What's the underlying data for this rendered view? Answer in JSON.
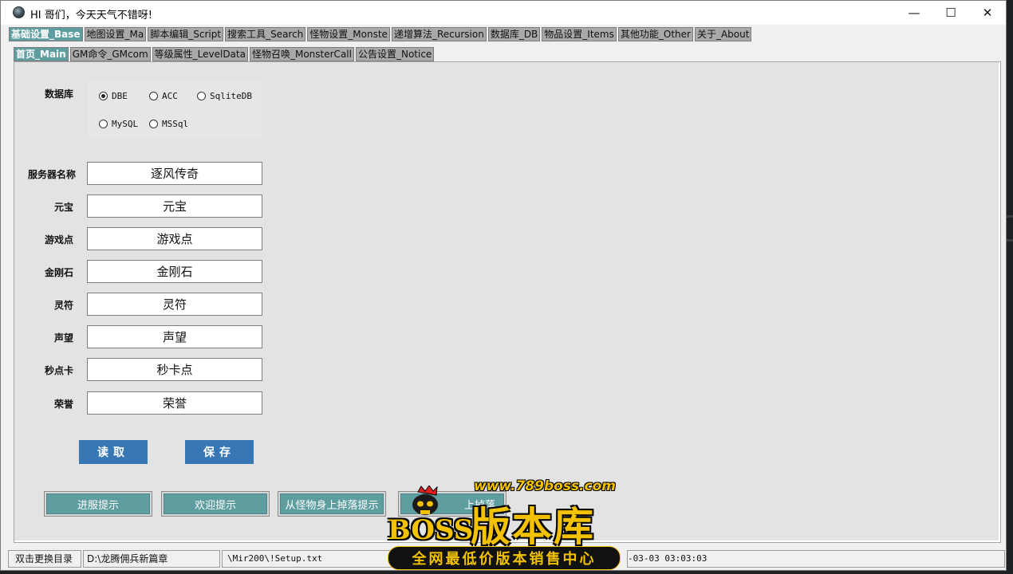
{
  "window": {
    "title": "HI 哥们，今天天气不错呀!",
    "minimize_glyph": "—",
    "maximize_glyph": "☐",
    "close_glyph": "✕"
  },
  "main_tabs": [
    {
      "label": "基础设置_Base",
      "active": true
    },
    {
      "label": "地图设置_Ma",
      "active": false
    },
    {
      "label": "脚本编辑_Script",
      "active": false
    },
    {
      "label": "搜索工具_Search",
      "active": false
    },
    {
      "label": "怪物设置_Monste",
      "active": false
    },
    {
      "label": "递增算法_Recursion",
      "active": false
    },
    {
      "label": "数据库_DB",
      "active": false
    },
    {
      "label": "物品设置_Items",
      "active": false
    },
    {
      "label": "其他功能_Other",
      "active": false
    },
    {
      "label": "关于_About",
      "active": false
    }
  ],
  "sub_tabs": [
    {
      "label": "首页_Main",
      "active": true
    },
    {
      "label": "GM命令_GMcom",
      "active": false
    },
    {
      "label": "等级属性_LevelData",
      "active": false
    },
    {
      "label": "怪物召唤_MonsterCall",
      "active": false
    },
    {
      "label": "公告设置_Notice",
      "active": false
    }
  ],
  "database": {
    "label": "数据库",
    "options": [
      {
        "label": "DBE",
        "selected": true
      },
      {
        "label": "ACC",
        "selected": false
      },
      {
        "label": "SqliteDB",
        "selected": false
      },
      {
        "label": "MySQL",
        "selected": false
      },
      {
        "label": "MSSql",
        "selected": false
      }
    ]
  },
  "fields": [
    {
      "label": "服务器名称",
      "value": "逐风传奇"
    },
    {
      "label": "元宝",
      "value": "元宝"
    },
    {
      "label": "游戏点",
      "value": "游戏点"
    },
    {
      "label": "金刚石",
      "value": "金刚石"
    },
    {
      "label": "灵符",
      "value": "灵符"
    },
    {
      "label": "声望",
      "value": "声望"
    },
    {
      "label": "秒点卡",
      "value": "秒卡点"
    },
    {
      "label": "荣誉",
      "value": "荣誉"
    }
  ],
  "buttons": {
    "read": "读取",
    "save": "保存",
    "enter_tip": "进服提示",
    "welcome_tip": "欢迎提示",
    "monster_drop_tip": "从怪物身上掉落提示",
    "drop_tip": "上掉落"
  },
  "status": {
    "change_dir": "双击更换目录",
    "dir": "D:\\龙腾佣兵新篇章",
    "setup_file": "\\Mir200\\!Setup.txt",
    "datetime": "-03-03 03:03:03"
  },
  "watermark": {
    "url": "www.789boss.com",
    "brand": "BOSS",
    "title": "版本库",
    "subtitle": "全网最低价版本销售中心"
  }
}
